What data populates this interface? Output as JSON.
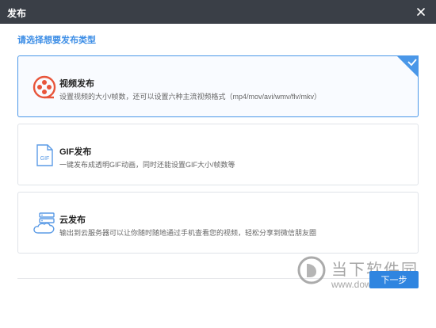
{
  "window": {
    "title": "发布",
    "close_icon": "close-icon"
  },
  "prompt": "请选择想要发布类型",
  "options": [
    {
      "name": "视频发布",
      "description": "设置视频的大小/帧数，还可以设置六种主流视频格式（mp4/mov/avi/wmv/flv/mkv）",
      "icon": "film-reel-icon",
      "selected": true
    },
    {
      "name": "GIF发布",
      "description": "一键发布成透明GIF动画，同时还能设置GIF大小/帧数等",
      "icon": "gif-file-icon",
      "icon_text": "GIF",
      "selected": false
    },
    {
      "name": "云发布",
      "description": "输出到云服务器可以让你随时随地通过手机查看您的视频，轻松分享到微信朋友圈",
      "icon": "cloud-server-icon",
      "selected": false
    }
  ],
  "next_button": "下一步",
  "watermark": {
    "brand": "当下软件园",
    "site": "www.downxia.com"
  },
  "colors": {
    "titlebar": "#3a3f47",
    "accent": "#2f85e0",
    "selected_border": "#4a97e8",
    "video_icon": "#e8553b",
    "file_icon": "#5b9be6"
  }
}
